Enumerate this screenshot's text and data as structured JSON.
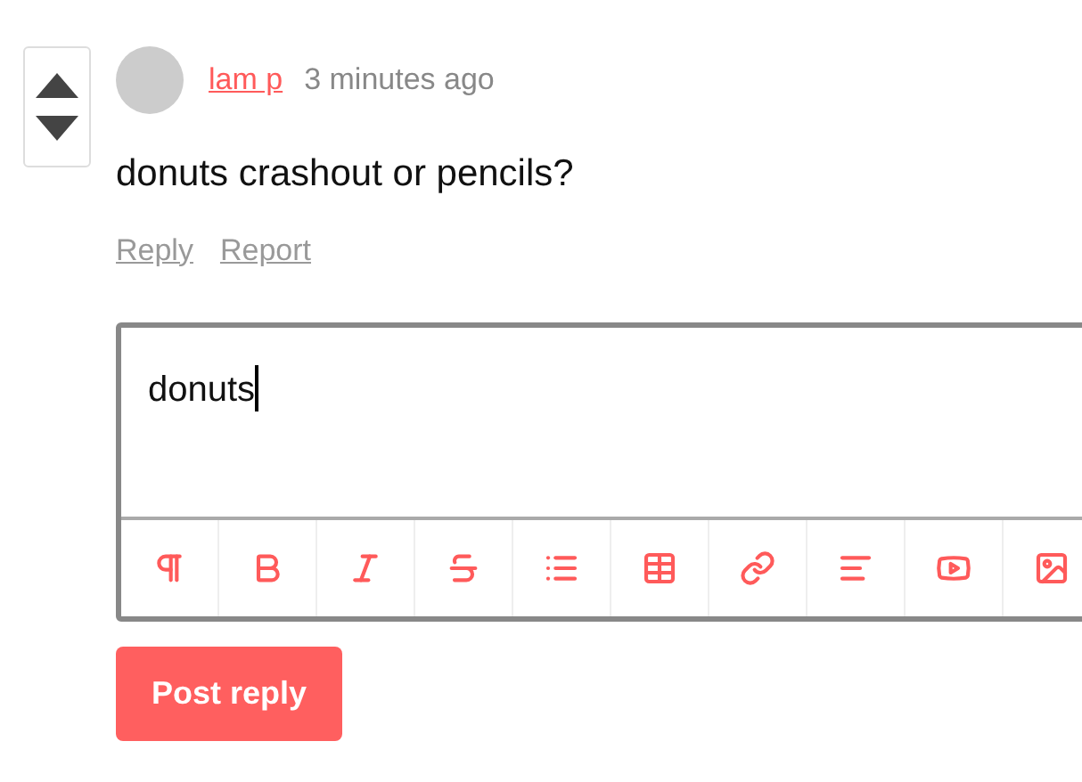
{
  "comment": {
    "author": "lam p",
    "time": "3 minutes ago",
    "text": "donuts crashout or pencils?",
    "actions": [
      "Reply",
      "Report"
    ]
  },
  "reply_editor": {
    "value": "donuts"
  },
  "submit_button": "Post reply"
}
